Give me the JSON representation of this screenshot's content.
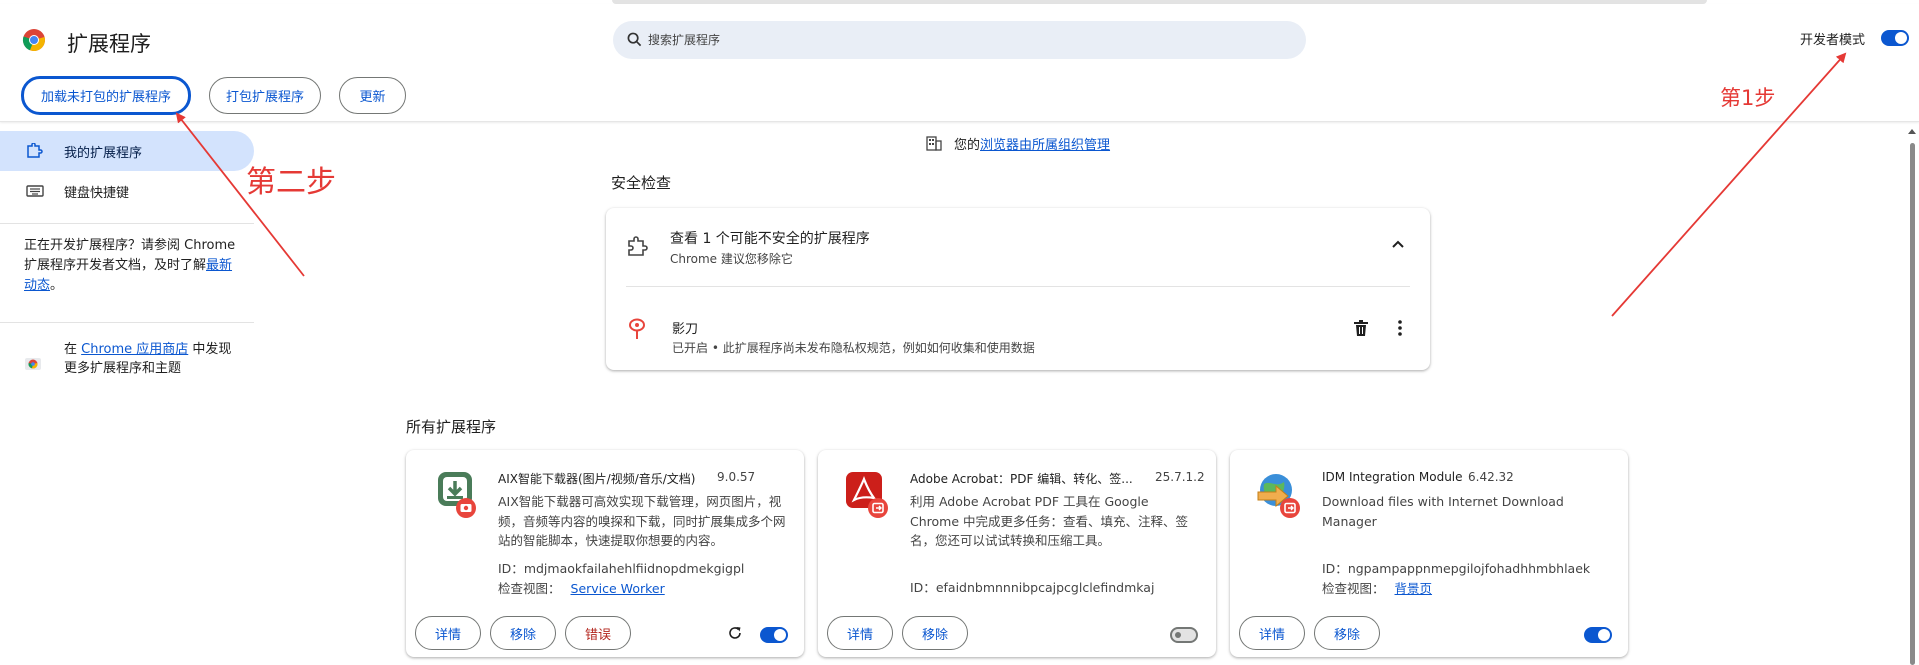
{
  "header": {
    "title": "扩展程序",
    "search_placeholder": "搜索扩展程序",
    "dev_mode_label": "开发者模式",
    "dev_mode_enabled": true,
    "buttons": {
      "load_unpacked": "加载未打包的扩展程序",
      "pack": "打包扩展程序",
      "update": "更新"
    }
  },
  "sidebar": {
    "items": [
      {
        "label": "我的扩展程序",
        "icon": "puzzle-icon",
        "active": true
      },
      {
        "label": "键盘快捷键",
        "icon": "keyboard-icon",
        "active": false
      }
    ],
    "dev_text_prefix": "正在开发扩展程序？请参阅 Chrome 扩展程序开发者文档，及时了解",
    "dev_text_link": "最新动态",
    "dev_text_suffix": "。",
    "webstore_prefix": "在 ",
    "webstore_link": "Chrome 应用商店",
    "webstore_suffix": " 中发现更多扩展程序和主题"
  },
  "managed": {
    "prefix": "您的",
    "link": "浏览器由所属组织管理"
  },
  "safety": {
    "section_title": "安全检查",
    "title": "查看 1 个可能不安全的扩展程序",
    "subtitle": "Chrome 建议您移除它",
    "ext_name": "影刀",
    "ext_desc": "已开启 • 此扩展程序尚未发布隐私权规范，例如如何收集和使用数据"
  },
  "all_extensions": {
    "section_title": "所有扩展程序",
    "inspect_label": "检查视图：",
    "id_label": "ID：",
    "detail_label": "详情",
    "remove_label": "移除",
    "error_label": "错误",
    "cards": [
      {
        "name": "AIX智能下载器(图片/视频/音乐/文档)",
        "version": "9.0.57",
        "desc": "AIX智能下载器可高效实现下载管理，网页图片，视频，音频等内容的嗅探和下载，同时扩展集成多个网站的智能脚本，快速提取你想要的内容。",
        "id": "mdjmaokfailahehlfiidnopdmekgigpl",
        "inspect_link": "Service Worker",
        "enabled": true
      },
      {
        "name": "Adobe Acrobat：PDF 编辑、转化、签...",
        "version": "25.7.1.2",
        "desc": "利用 Adobe Acrobat PDF 工具在 Google Chrome 中完成更多任务：查看、填充、注释、签名，您还可以试试转换和压缩工具。",
        "id": "efaidnbmnnnibpcajpcglclefindmkaj",
        "inspect_link": "",
        "enabled": false
      },
      {
        "name": "IDM Integration Module",
        "version": "6.42.32",
        "desc": "Download files with Internet Download Manager",
        "id": "ngpampappnmepgilojfohadhhmbhlaek",
        "inspect_link": "背景页",
        "enabled": true
      }
    ]
  },
  "annotations": {
    "step1": "第1步",
    "step2": "第二步"
  },
  "colors": {
    "accent": "#0b57d0",
    "annotation": "#e53935",
    "active_nav": "#d3e3fd",
    "search_bg": "#e9eef6"
  }
}
